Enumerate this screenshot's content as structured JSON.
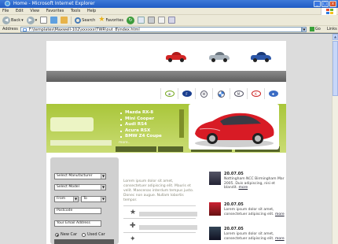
{
  "window": {
    "title": "Home - Microsoft Internet Explorer",
    "controls": [
      "_",
      "□",
      "x"
    ]
  },
  "menu": [
    "File",
    "Edit",
    "View",
    "Favorites",
    "Tools",
    "Help"
  ],
  "toolbar": {
    "back": "Back",
    "search": "Search",
    "favorites": "Favorites"
  },
  "address": {
    "label": "Address",
    "url": "F:\\templates\\Maxwell-102\\xxxxxx\\TWR\\out_8\\index.html",
    "go": "Go",
    "links": "Links"
  },
  "site": {
    "models": [
      "Mazda RX-8",
      "Mini Cooper",
      "Audi RS4",
      "Acura RSX",
      "BMW Z4 Coupe"
    ],
    "more_link": "more..",
    "brands": [
      "Alfa Romeo",
      "Ford",
      "VW",
      "BMW",
      "Mazda",
      "Kia",
      "Chevrolet"
    ],
    "form": {
      "manufacturer": "Select Manufacturer",
      "model": "Select Model",
      "from": "From",
      "to": "To",
      "postcode": "Postcode",
      "email": "Your Email Address",
      "new_car": "New Car",
      "used_car": "Used Car"
    },
    "intro": "Lorem ipsum dolor sit amet, consectetuer adipiscing elit. Mauris et velit. Maecenas interdum tempus justo. Donec non augue. Nullam lobortis tempor.",
    "news": [
      {
        "date": "20.07.05",
        "text": "Nottingham NCC Birmingham Mar 2005. Duis adipiscing, nisi et blandit.",
        "link": "more"
      },
      {
        "date": "20.07.05",
        "text": "Lorem ipsum dolor sit amet, consectetuer adipiscing elit.",
        "link": "more"
      },
      {
        "date": "20.07.05",
        "text": "Lorem ipsum dolor sit amet, consectetuer adipiscing elit.",
        "link": "more"
      }
    ]
  },
  "colors": {
    "xp_title": "#1f5bc4",
    "olive_green": "#a9c63a",
    "dark_bar": "#5e5e5e",
    "hero_car": "#d81b25"
  }
}
